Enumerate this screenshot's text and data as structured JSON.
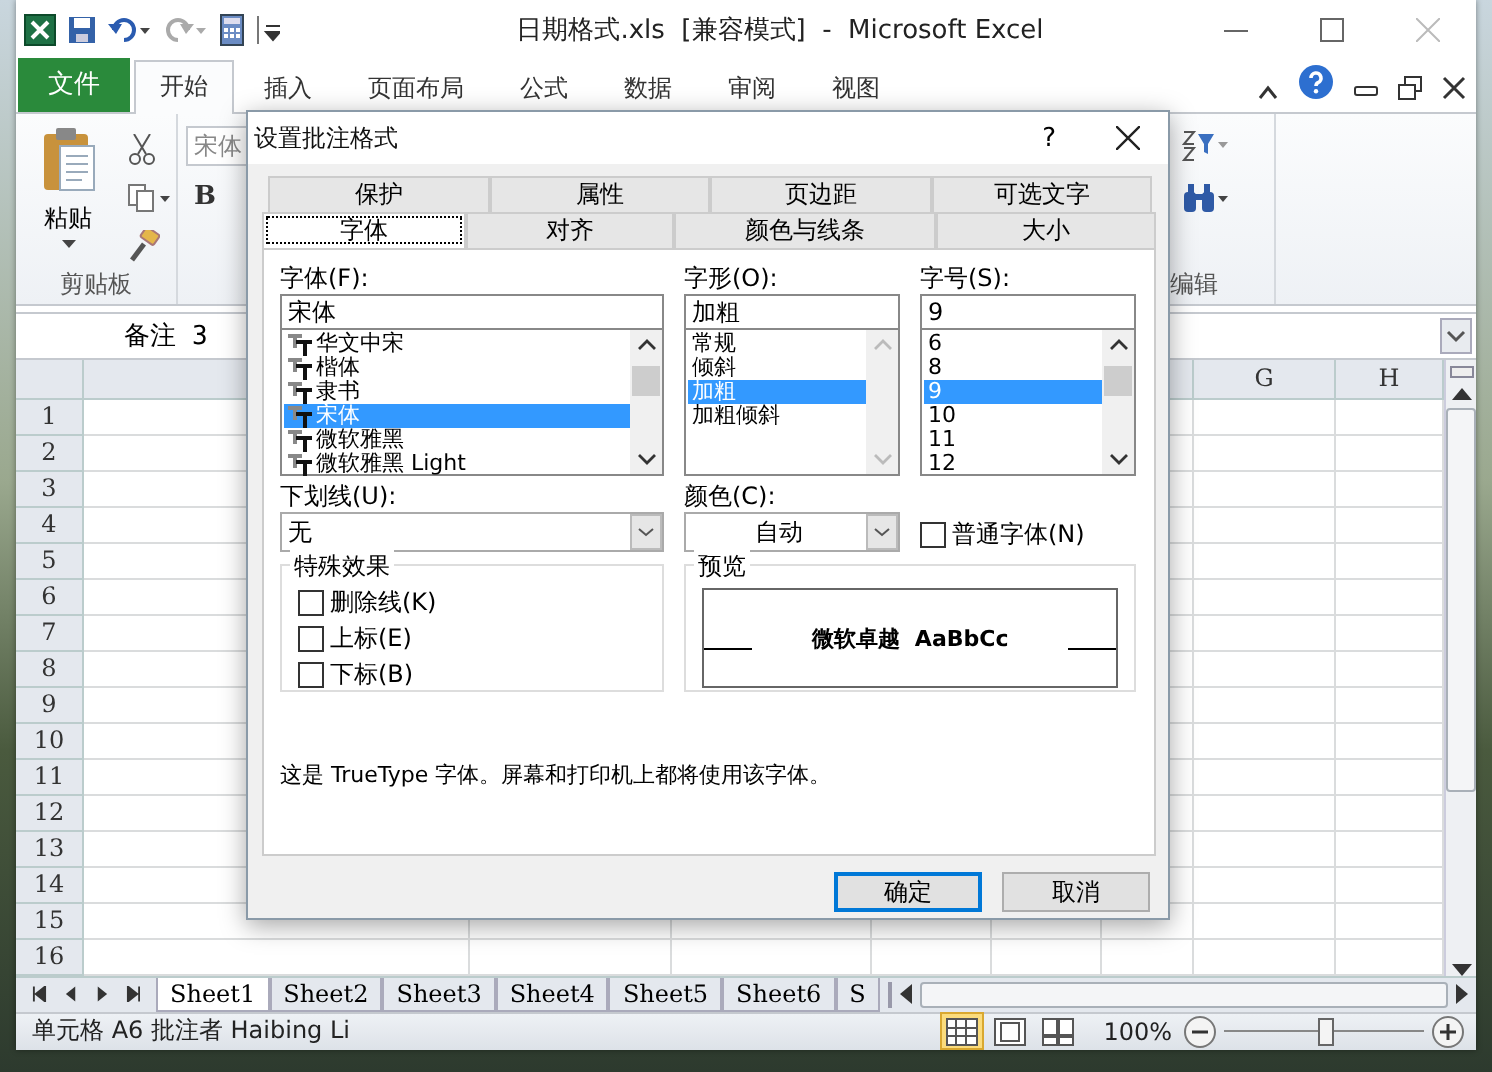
{
  "window": {
    "title": "日期格式.xls  [兼容模式]  -  Microsoft Excel"
  },
  "ribbon_tabs": [
    {
      "label": "文件",
      "kind": "file",
      "selected": false
    },
    {
      "label": "开始",
      "kind": "tab",
      "selected": true
    },
    {
      "label": "插入",
      "kind": "tab",
      "selected": false
    },
    {
      "label": "页面布局",
      "kind": "tab",
      "selected": false
    },
    {
      "label": "公式",
      "kind": "tab",
      "selected": false
    },
    {
      "label": "数据",
      "kind": "tab",
      "selected": false
    },
    {
      "label": "审阅",
      "kind": "tab",
      "selected": false
    },
    {
      "label": "视图",
      "kind": "tab",
      "selected": false
    }
  ],
  "ribbon": {
    "paste_label": "粘贴",
    "clipboard_group": "剪贴板",
    "font_box": "宋体",
    "bold_button": "B",
    "editing_group": "编辑"
  },
  "name_box": "备注 3",
  "columns": [
    {
      "label": "G"
    },
    {
      "label": "H"
    }
  ],
  "rows": [
    "1",
    "2",
    "3",
    "4",
    "5",
    "6",
    "7",
    "8",
    "9",
    "10",
    "11",
    "12",
    "13",
    "14",
    "15",
    "16"
  ],
  "sheet_tabs": [
    {
      "label": "Sheet1",
      "selected": true
    },
    {
      "label": "Sheet2",
      "selected": false
    },
    {
      "label": "Sheet3",
      "selected": false
    },
    {
      "label": "Sheet4",
      "selected": false
    },
    {
      "label": "Sheet5",
      "selected": false
    },
    {
      "label": "Sheet6",
      "selected": false
    },
    {
      "label": "S",
      "selected": false
    }
  ],
  "status_bar": {
    "text": "单元格 A6 批注者 Haibing Li",
    "views": [
      {
        "kind": "normal",
        "selected": true
      },
      {
        "kind": "layout",
        "selected": false
      },
      {
        "kind": "pagebreak",
        "selected": false
      }
    ],
    "zoom": "100%",
    "zoom_slider": {
      "level": 0.5
    }
  },
  "dialog": {
    "title": "设置批注格式",
    "help": "?",
    "tab_rows": [
      [
        {
          "label": "保护",
          "selected": false
        },
        {
          "label": "属性",
          "selected": false
        },
        {
          "label": "页边距",
          "selected": false
        },
        {
          "label": "可选文字",
          "selected": false
        }
      ],
      [
        {
          "label": "字体",
          "selected": true
        },
        {
          "label": "对齐",
          "selected": false
        },
        {
          "label": "颜色与线条",
          "selected": false
        },
        {
          "label": "大小",
          "selected": false
        }
      ]
    ],
    "font": {
      "label": "字体(F):",
      "value": "宋体",
      "items": [
        {
          "label": "华文中宋",
          "selected": false
        },
        {
          "label": "楷体",
          "selected": false
        },
        {
          "label": "隶书",
          "selected": false
        },
        {
          "label": "宋体",
          "selected": true
        },
        {
          "label": "微软雅黑",
          "selected": false
        },
        {
          "label": "微软雅黑 Light",
          "selected": false
        }
      ]
    },
    "style": {
      "label": "字形(O):",
      "value": "加粗",
      "items": [
        {
          "label": "常规",
          "selected": false
        },
        {
          "label": "倾斜",
          "selected": false
        },
        {
          "label": "加粗",
          "selected": true
        },
        {
          "label": "加粗倾斜",
          "selected": false
        }
      ]
    },
    "size": {
      "label": "字号(S):",
      "value": "9",
      "items": [
        {
          "label": "6",
          "selected": false
        },
        {
          "label": "8",
          "selected": false
        },
        {
          "label": "9",
          "selected": true
        },
        {
          "label": "10",
          "selected": false
        },
        {
          "label": "11",
          "selected": false
        },
        {
          "label": "12",
          "selected": false
        }
      ]
    },
    "underline": {
      "label": "下划线(U):",
      "value": "无"
    },
    "color": {
      "label": "颜色(C):",
      "value": "自动"
    },
    "normal_font": {
      "label": "普通字体(N)",
      "checked": false
    },
    "effects": {
      "title": "特殊效果",
      "items": [
        {
          "label": "删除线(K)",
          "checked": false
        },
        {
          "label": "上标(E)",
          "checked": false
        },
        {
          "label": "下标(B)",
          "checked": false
        }
      ]
    },
    "preview": {
      "title": "预览",
      "sample": "微软卓越  AaBbCc"
    },
    "note": "这是 TrueType 字体。屏幕和打印机上都将使用该字体。",
    "buttons": [
      {
        "label": "确定",
        "kind": "default"
      },
      {
        "label": "取消",
        "kind": "normal"
      }
    ]
  }
}
